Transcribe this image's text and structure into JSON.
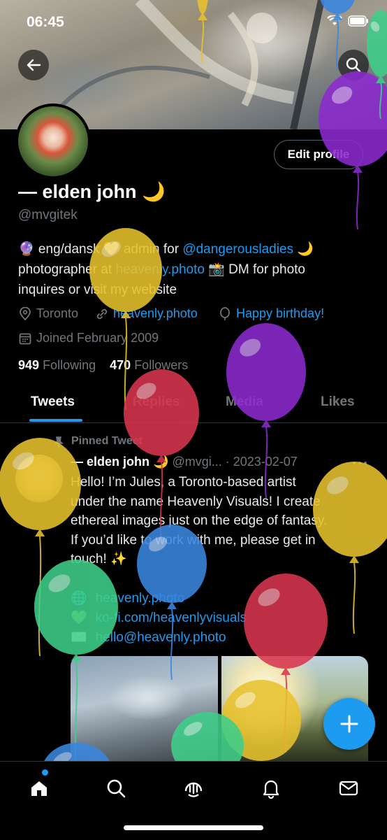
{
  "status_bar": {
    "time": "06:45"
  },
  "profile": {
    "edit_button": "Edit profile",
    "name": "— elden john 🌙",
    "handle": "@mvgitek",
    "bio": {
      "line1_a": "🔮 eng/dansk 💛 admin for ",
      "line1_link": "@dangerousladies",
      "line1_b": " 🌙",
      "line2_a": "photographer at ",
      "line2_link": "heavenly.photo",
      "line2_b": " 📸 DM for photo",
      "line3": "inquires or visit my website"
    },
    "location": "Toronto",
    "website": "heavenly.photo",
    "birthday": "Happy birthday!",
    "joined": "Joined February 2009",
    "following_count": "949",
    "following_label": "Following",
    "followers_count": "470",
    "followers_label": "Followers"
  },
  "tabs": [
    "Tweets",
    "Replies",
    "Media",
    "Likes"
  ],
  "pinned_tweet": {
    "pinned_label": "Pinned Tweet",
    "author_name": "— elden john 🌙",
    "author_handle_date": "@mvgi... · 2023-02-07",
    "body_lines": [
      "Hello! I’m Jules, a Toronto-based artist",
      "under the name Heavenly Visuals! I create",
      "ethereal images just on the edge of fantasy.",
      "If you’d like to work with me, please get in",
      "touch! ✨"
    ],
    "links": [
      {
        "emoji": "🌐",
        "text": "heavenly.photo"
      },
      {
        "emoji": "💚",
        "text": "ko-fi.com/heavenlyvisuals"
      },
      {
        "emoji": "✉️",
        "text": "hello@heavenly.photo"
      }
    ]
  },
  "icons": {
    "back": "back-arrow-icon",
    "search": "search-icon",
    "fab": "compose-plus-icon",
    "nav": [
      "home-icon",
      "search-icon",
      "spaces-icon",
      "notifications-icon",
      "messages-icon"
    ]
  },
  "colors": {
    "accent": "#1d9bf0",
    "muted": "#71767b",
    "background": "#000000",
    "balloon_yellow": "#e8c22e",
    "balloon_red": "#d9364f",
    "balloon_purple": "#8d2bd0",
    "balloon_green": "#3fcf8a",
    "balloon_blue": "#3a87e0"
  }
}
